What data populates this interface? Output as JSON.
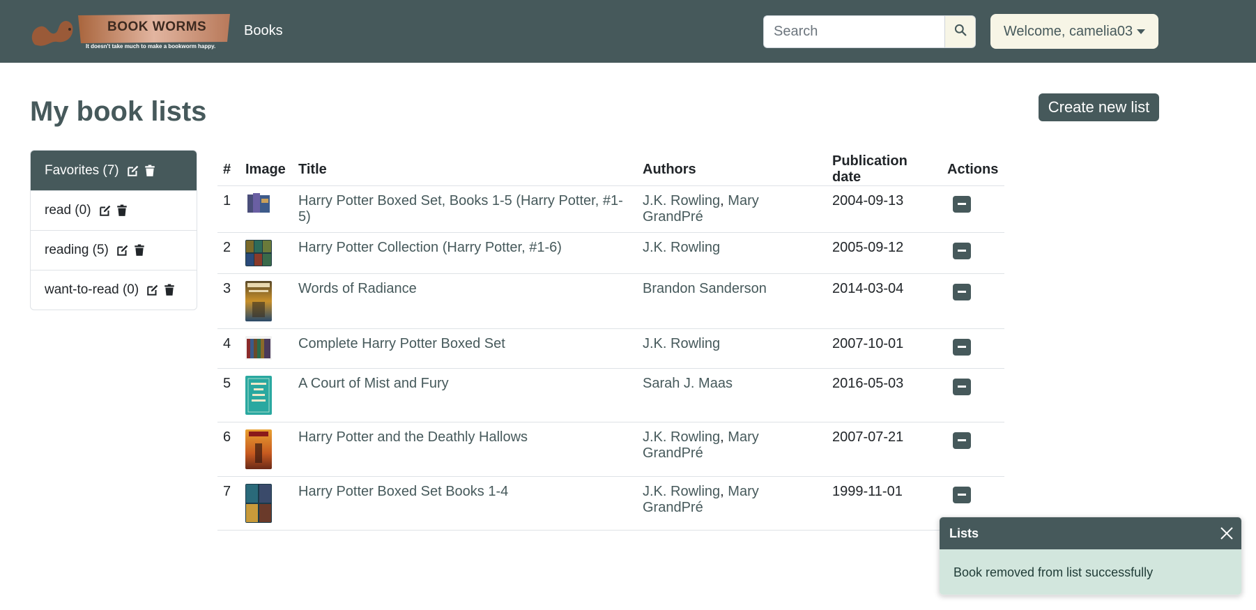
{
  "navbar": {
    "logo_text": "BOOK WORMS",
    "logo_tagline": "It doesn't take much to make a bookworm happy.",
    "books_link": "Books",
    "search_placeholder": "Search",
    "user_menu_label": "Welcome, camelia03",
    "icons": {
      "search": "search-icon",
      "caret": "chevron-down-icon"
    }
  },
  "page": {
    "title": "My book lists",
    "create_button": "Create new list"
  },
  "lists": [
    {
      "label": "Favorites (7)",
      "active": true
    },
    {
      "label": "read (0)",
      "active": false
    },
    {
      "label": "reading (5)",
      "active": false
    },
    {
      "label": "want-to-read (0)",
      "active": false
    }
  ],
  "table": {
    "headers": [
      "#",
      "Image",
      "Title",
      "Authors",
      "Publication date",
      "Actions"
    ],
    "rows": [
      {
        "num": "1",
        "title": "Harry Potter Boxed Set, Books 1-5 (Harry Potter, #1-5)",
        "authors": [
          "J.K. Rowling",
          "Mary GrandPré"
        ],
        "date": "2004-09-13"
      },
      {
        "num": "2",
        "title": "Harry Potter Collection (Harry Potter, #1-6)",
        "authors": [
          "J.K. Rowling"
        ],
        "date": "2005-09-12"
      },
      {
        "num": "3",
        "title": "Words of Radiance",
        "authors": [
          "Brandon Sanderson"
        ],
        "date": "2014-03-04"
      },
      {
        "num": "4",
        "title": "Complete Harry Potter Boxed Set",
        "authors": [
          "J.K. Rowling"
        ],
        "date": "2007-10-01"
      },
      {
        "num": "5",
        "title": "A Court of Mist and Fury",
        "authors": [
          "Sarah J. Maas"
        ],
        "date": "2016-05-03"
      },
      {
        "num": "6",
        "title": "Harry Potter and the Deathly Hallows",
        "authors": [
          "J.K. Rowling",
          "Mary GrandPré"
        ],
        "date": "2007-07-21"
      },
      {
        "num": "7",
        "title": "Harry Potter Boxed Set Books 1-4",
        "authors": [
          "J.K. Rowling",
          "Mary GrandPré"
        ],
        "date": "1999-11-01"
      }
    ]
  },
  "toast": {
    "title": "Lists",
    "message": "Book removed from list successfully"
  },
  "colors": {
    "primary": "#46595b",
    "cream": "#f7f5e6",
    "toast_body": "#d2e6dd"
  }
}
